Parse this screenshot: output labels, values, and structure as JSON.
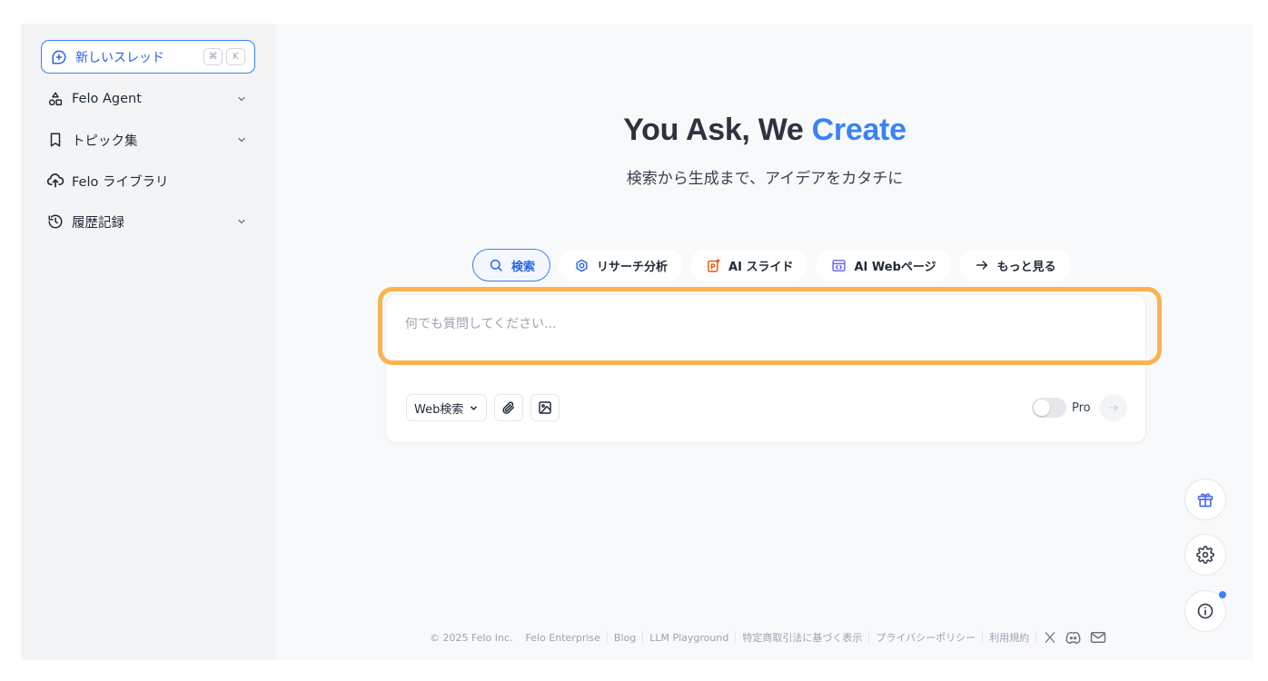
{
  "sidebar": {
    "new_thread": {
      "label": "新しいスレッド",
      "shortcut": [
        "⌘",
        "K"
      ]
    },
    "items": [
      {
        "label": "Felo Agent",
        "icon": "agent-shapes-icon",
        "expandable": true
      },
      {
        "label": "トピック集",
        "icon": "bookmark-icon",
        "expandable": true
      },
      {
        "label": "Felo ライブラリ",
        "icon": "cloud-upload-icon",
        "expandable": false
      },
      {
        "label": "履歴記録",
        "icon": "history-icon",
        "expandable": true
      }
    ]
  },
  "hero": {
    "title_prefix": "You Ask, We ",
    "title_accent": "Create",
    "subtitle": "検索から生成まで、アイデアをカタチに"
  },
  "modes": [
    {
      "label": "検索",
      "icon": "search-icon",
      "active": true
    },
    {
      "label": "リサーチ分析",
      "icon": "research-icon",
      "active": false
    },
    {
      "label": "AI スライド",
      "icon": "slides-icon",
      "active": false
    },
    {
      "label": "AI Webページ",
      "icon": "web-page-icon",
      "active": false
    },
    {
      "label": "もっと見る",
      "icon": "arrow-right-icon",
      "active": false
    }
  ],
  "search": {
    "placeholder": "何でも質問してください...",
    "value": "",
    "source_select": "Web検索",
    "pro_label": "Pro"
  },
  "footer": {
    "copyright": "© 2025  Felo Inc.",
    "links": [
      "Felo Enterprise",
      "Blog",
      "LLM Playground",
      "特定商取引法に基づく表示",
      "プライバシーポリシー",
      "利用規約"
    ]
  },
  "colors": {
    "accent": "#3b82f6",
    "highlight": "#fbb24f",
    "slides_icon": "#ea580c",
    "web_icon": "#6366f1",
    "notification_dot": "#3b82f6"
  }
}
